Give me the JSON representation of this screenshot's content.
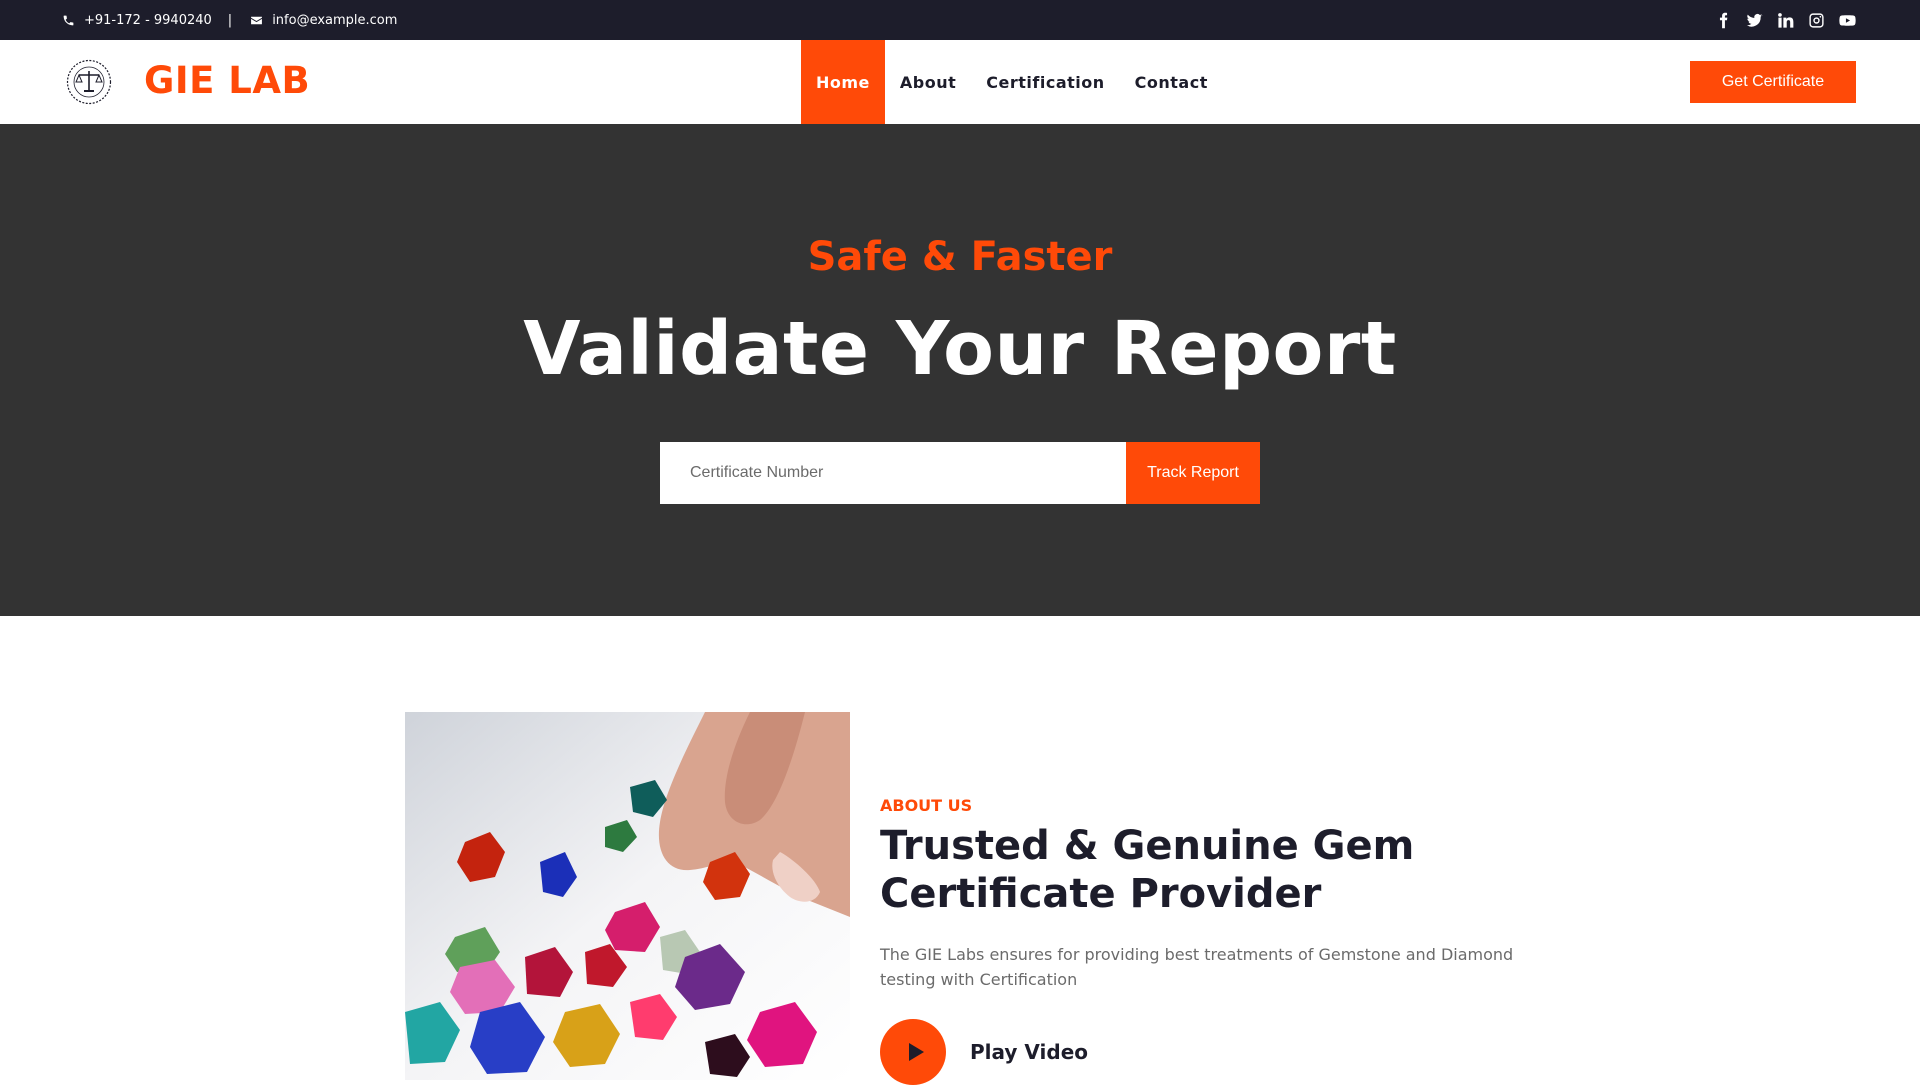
{
  "topbar": {
    "phone": "+91-172 - 9940240",
    "separator": "|",
    "email": "info@example.com",
    "socials": [
      "facebook-icon",
      "twitter-icon",
      "linkedin-icon",
      "instagram-icon",
      "youtube-icon"
    ]
  },
  "header": {
    "brand": "GIE LAB",
    "nav": [
      {
        "label": "Home",
        "active": true
      },
      {
        "label": "About",
        "active": false
      },
      {
        "label": "Certification",
        "active": false
      },
      {
        "label": "Contact",
        "active": false
      }
    ],
    "cta_label": "Get Certificate"
  },
  "hero": {
    "kicker": "Safe & Faster",
    "title": "Validate Your Report",
    "search_placeholder": "Certificate Number",
    "button_label": "Track Report"
  },
  "about": {
    "label": "ABOUT US",
    "heading": "Trusted & Genuine Gem Certificate Provider",
    "description": "The GIE Labs ensures for providing best treatments of Gemstone and Diamond testing with Certification",
    "play_label": "Play Video"
  },
  "colors": {
    "accent": "#ff4a08",
    "topbar_bg": "#1d1d2b",
    "hero_bg": "#333333",
    "heading_text": "#1d1d2b",
    "body_text": "#6b6b6b"
  }
}
